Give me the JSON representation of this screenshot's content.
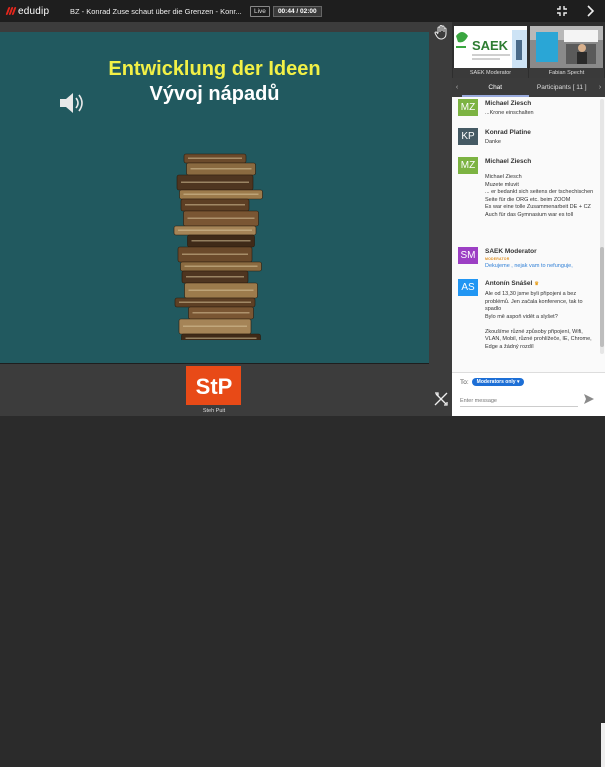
{
  "header": {
    "logo_text": "edudip",
    "webinar_title": "BZ - Konrad Zuse schaut über die Grenzen - Konr...",
    "live_label": "Live",
    "timer": "00:44 / 02:00"
  },
  "slide": {
    "heading_de": "Entwicklung der Ideen",
    "heading_cz": "Vývoj nápadů"
  },
  "presenter": {
    "initials": "StP",
    "name": "Steh Puit"
  },
  "cameras": [
    {
      "label": "SAEK Moderator",
      "logo_text": "SAEK"
    },
    {
      "label": "Fabian Specht"
    }
  ],
  "tabs": {
    "chat": "Chat",
    "participants": "Participants [ 11 ]"
  },
  "chat": {
    "messages": [
      {
        "initials": "MZ",
        "color": "#7cb342",
        "name": "Michael Ziesch",
        "role": "",
        "text": "...Krone einschalten",
        "text_color": "#333333"
      },
      {
        "initials": "KP",
        "color": "#455a64",
        "name": "Konrad Platine",
        "role": "",
        "text": "Danke",
        "text_color": "#333333"
      },
      {
        "initials": "MZ",
        "color": "#7cb342",
        "name": "Michael Ziesch",
        "role": "",
        "text": "Michael Ziesch\nMuzete mluvit\n... er bedankt sich seitens der tschechischen Seite für die ORG etc. beim ZOOM\nEs war eine tolle Zusammenarbeit DE + CZ\nAuch für das Gymnasium war es toll",
        "text_color": "#333333"
      },
      {
        "initials": "SM",
        "color": "#9c3fc4",
        "name": "SAEK Moderator",
        "role": "MODERATOR",
        "text": "Dekujeme , nejak vam to nefunguje,",
        "text_color": "#2f7fd6"
      },
      {
        "initials": "AS",
        "color": "#2196f3",
        "name": "Antonín Snášel",
        "role": "",
        "text": "Ale od 13,30 jsme byli připojeni a bez problémů. Jen začala konference, tak to spadlo\nBylo mě aspoň vidět a slyšet?\n\nZkoušíme různé způsoby připojení, Wifi, VLAN, Mobil, různé prohlížeče, IE, Chrome, Edge a žádný rozdíl",
        "text_color": "#333333"
      }
    ]
  },
  "composer": {
    "to_label": "To:",
    "recipient": "Moderators only",
    "placeholder": "Enter message"
  },
  "colors": {
    "slide_bg": "#21595f",
    "heading_yellow": "#f2f046",
    "brand_red": "#e2261c",
    "presenter_orange": "#e84a17",
    "accent_blue": "#1d6fd6"
  },
  "icons": [
    "speaker-icon",
    "raise-hand-icon",
    "tools-icon",
    "fullscreen-icon",
    "collapse-panel-icon",
    "send-icon",
    "crown-icon"
  ]
}
